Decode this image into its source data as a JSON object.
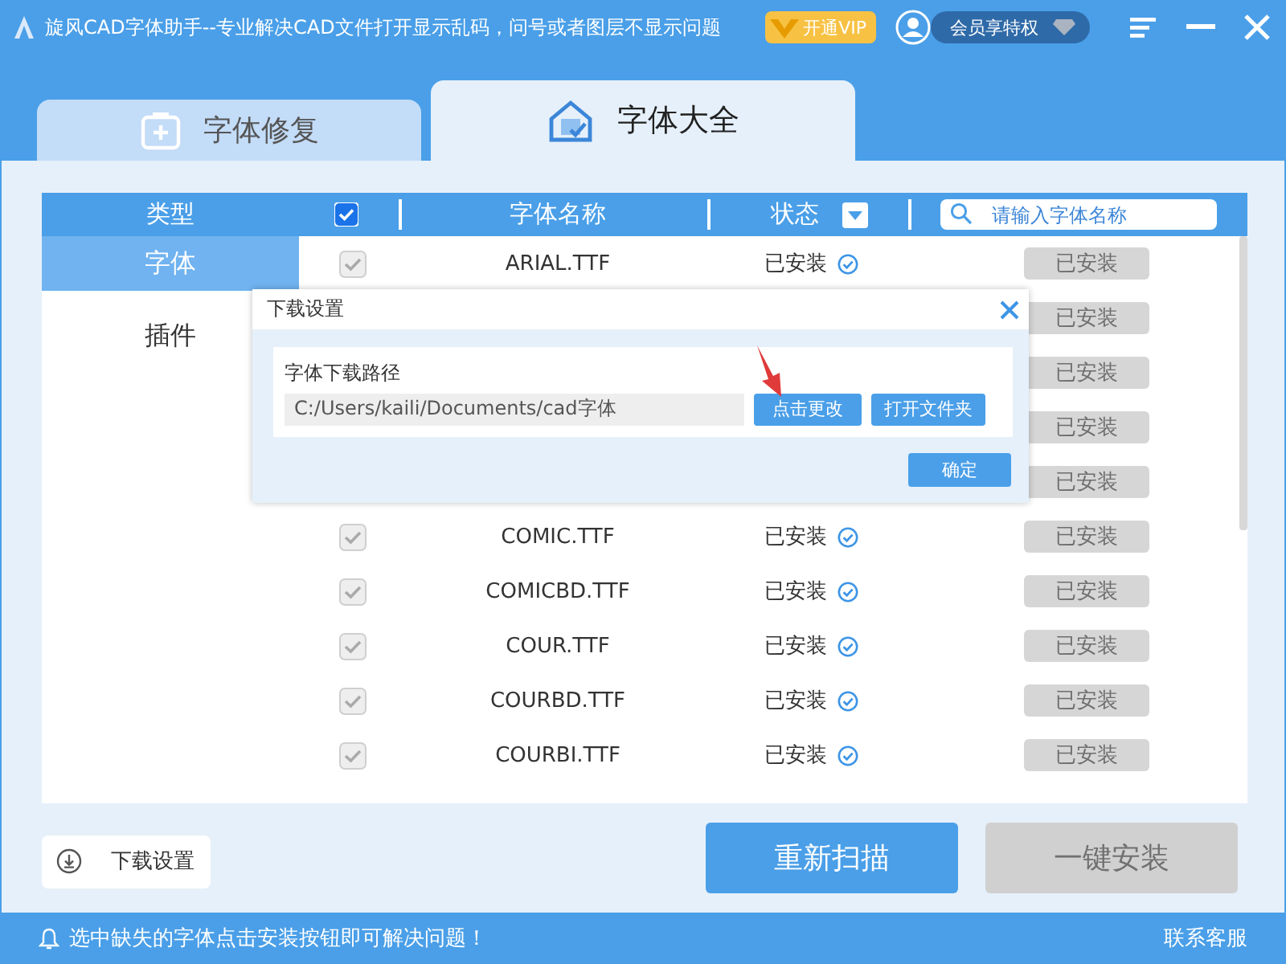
{
  "window": {
    "title": "旋风CAD字体助手--专业解决CAD文件打开显示乱码，问号或者图层不显示问题",
    "vip_button": "开通VIP",
    "member_button": "会员享特权"
  },
  "tabs": [
    {
      "label": "字体修复",
      "selected": false
    },
    {
      "label": "字体大全",
      "selected": true
    }
  ],
  "table": {
    "columns": [
      "类型",
      "字体名称",
      "状态"
    ],
    "select_all": true,
    "search": {
      "placeholder": "请输入字体名称"
    },
    "categories": [
      {
        "label": "字体",
        "selected": true
      },
      {
        "label": "插件",
        "selected": false
      }
    ],
    "rows": [
      {
        "checked": true,
        "name": "ARIAL.TTF",
        "status": "已安装",
        "action": "已安装"
      },
      {
        "action": "已安装"
      },
      {
        "action": "已安装"
      },
      {
        "action": "已安装"
      },
      {
        "action": "已安装"
      },
      {
        "checked": true,
        "name": "COMIC.TTF",
        "status": "已安装",
        "action": "已安装"
      },
      {
        "checked": true,
        "name": "COMICBD.TTF",
        "status": "已安装",
        "action": "已安装"
      },
      {
        "checked": true,
        "name": "COUR.TTF",
        "status": "已安装",
        "action": "已安装"
      },
      {
        "checked": true,
        "name": "COURBD.TTF",
        "status": "已安装",
        "action": "已安装"
      },
      {
        "checked": true,
        "name": "COURBI.TTF",
        "status": "已安装",
        "action": "已安装"
      }
    ]
  },
  "dialog": {
    "title": "下载设置",
    "path_label": "字体下载路径",
    "path": "C:/Users/kaili/Documents/cad字体",
    "buttons": [
      "点击更改",
      "打开文件夹"
    ],
    "confirm": "确定"
  },
  "download_settings_button": "下载设置",
  "rescan_button": "重新扫描",
  "install_all": {
    "label": "一键安装",
    "disabled": true
  },
  "status_bar": {
    "message": "选中缺失的字体点击安装按钮即可解决问题！",
    "support_link": "联系客服"
  }
}
